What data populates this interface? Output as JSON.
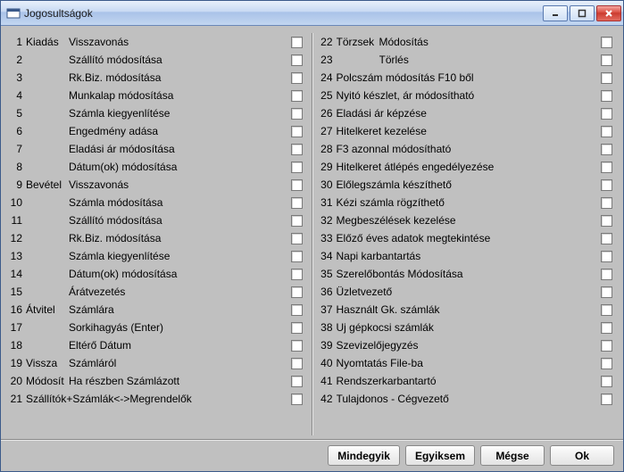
{
  "window": {
    "title": "Jogosultságok"
  },
  "left": [
    {
      "n": "1",
      "cat": "Kiadás",
      "label": "Visszavonás"
    },
    {
      "n": "2",
      "cat": "",
      "label": "Szállító módosítása"
    },
    {
      "n": "3",
      "cat": "",
      "label": "Rk.Biz. módosítása"
    },
    {
      "n": "4",
      "cat": "",
      "label": "Munkalap módosítása"
    },
    {
      "n": "5",
      "cat": "",
      "label": "Számla kiegyenlítése"
    },
    {
      "n": "6",
      "cat": "",
      "label": "Engedmény adása"
    },
    {
      "n": "7",
      "cat": "",
      "label": "Eladási ár módosítása"
    },
    {
      "n": "8",
      "cat": "",
      "label": "Dátum(ok) módosítása"
    },
    {
      "n": "9",
      "cat": "Bevétel",
      "label": "Visszavonás"
    },
    {
      "n": "10",
      "cat": "",
      "label": "Számla módosítása"
    },
    {
      "n": "11",
      "cat": "",
      "label": "Szállító módosítása"
    },
    {
      "n": "12",
      "cat": "",
      "label": "Rk.Biz. módosítása"
    },
    {
      "n": "13",
      "cat": "",
      "label": "Számla kiegyenlítése"
    },
    {
      "n": "14",
      "cat": "",
      "label": "Dátum(ok) módosítása"
    },
    {
      "n": "15",
      "cat": "",
      "label": "Árátvezetés"
    },
    {
      "n": "16",
      "cat": "Átvitel",
      "label": "Számlára"
    },
    {
      "n": "17",
      "cat": "",
      "label": "Sorkihagyás (Enter)"
    },
    {
      "n": "18",
      "cat": "",
      "label": "Eltérő Dátum"
    },
    {
      "n": "19",
      "cat": "Vissza",
      "label": "Számláról"
    },
    {
      "n": "20",
      "cat": "Módosít",
      "label": "Ha részben Számlázott"
    },
    {
      "n": "21",
      "cat": "",
      "label": "Szállítók+Számlák<->Megrendelők",
      "nocat": true
    }
  ],
  "right": [
    {
      "n": "22",
      "cat": "Törzsek",
      "label": "Módosítás"
    },
    {
      "n": "23",
      "cat": "",
      "label": "Törlés"
    },
    {
      "n": "24",
      "label": "Polcszám módosítás F10 ből"
    },
    {
      "n": "25",
      "label": "Nyitó készlet, ár módosítható"
    },
    {
      "n": "26",
      "label": "Eladási ár képzése"
    },
    {
      "n": "27",
      "label": "Hitelkeret kezelése"
    },
    {
      "n": "28",
      "label": "F3 azonnal módosítható"
    },
    {
      "n": "29",
      "label": "Hitelkeret átlépés engedélyezése"
    },
    {
      "n": "30",
      "label": "Előlegszámla készíthető"
    },
    {
      "n": "31",
      "label": "Kézi számla rögzíthető"
    },
    {
      "n": "32",
      "label": "Megbeszélések kezelése"
    },
    {
      "n": "33",
      "label": "Előző éves adatok megtekintése"
    },
    {
      "n": "34",
      "label": "Napi karbantartás"
    },
    {
      "n": "35",
      "label": "Szerelőbontás Módosítása"
    },
    {
      "n": "36",
      "label": "Üzletvezető"
    },
    {
      "n": "37",
      "label": "Használt Gk. számlák"
    },
    {
      "n": "38",
      "label": "Uj gépkocsi számlák"
    },
    {
      "n": "39",
      "label": "Szevizelőjegyzés"
    },
    {
      "n": "40",
      "label": "Nyomtatás File-ba"
    },
    {
      "n": "41",
      "label": "Rendszerkarbantartó"
    },
    {
      "n": "42",
      "label": "Tulajdonos - Cégvezető"
    }
  ],
  "buttons": {
    "all": "Mindegyik",
    "none": "Egyiksem",
    "cancel": "Mégse",
    "ok": "Ok"
  }
}
